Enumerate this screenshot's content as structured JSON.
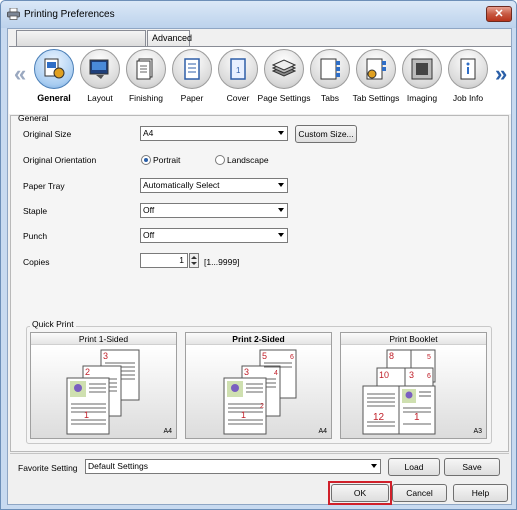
{
  "window": {
    "title": "Printing Preferences",
    "close_label": "✕",
    "app_icon": "printer-icon"
  },
  "tabs": [
    {
      "label": ""
    },
    {
      "label": "Advanced"
    }
  ],
  "nav": {
    "prev": "«",
    "next": "»"
  },
  "icon_tabs": [
    {
      "label": "General",
      "icon": "general-icon",
      "selected": true
    },
    {
      "label": "Layout",
      "icon": "layout-icon"
    },
    {
      "label": "Finishing",
      "icon": "finishing-icon"
    },
    {
      "label": "Paper",
      "icon": "paper-icon"
    },
    {
      "label": "Cover",
      "icon": "cover-icon"
    },
    {
      "label": "Page Settings",
      "icon": "page-settings-icon"
    },
    {
      "label": "Tabs",
      "icon": "tabs-icon"
    },
    {
      "label": "Tab Settings",
      "icon": "tab-settings-icon"
    },
    {
      "label": "Imaging",
      "icon": "imaging-icon"
    },
    {
      "label": "Job Info",
      "icon": "job-info-icon"
    }
  ],
  "general": {
    "title": "General",
    "original_size": {
      "label": "Original Size",
      "value": "A4",
      "custom_button": "Custom Size..."
    },
    "orientation": {
      "label": "Original Orientation",
      "portrait": "Portrait",
      "landscape": "Landscape",
      "selected": "Portrait"
    },
    "paper_tray": {
      "label": "Paper Tray",
      "value": "Automatically Select"
    },
    "staple": {
      "label": "Staple",
      "value": "Off"
    },
    "punch": {
      "label": "Punch",
      "value": "Off"
    },
    "copies": {
      "label": "Copies",
      "value": "1",
      "range": "[1...9999]"
    }
  },
  "quick_print": {
    "title": "Quick Print",
    "items": [
      {
        "label": "Print 1-Sided",
        "size": "A4",
        "pages": [
          "3",
          "2",
          "1"
        ]
      },
      {
        "label": "Print 2-Sided",
        "size": "A4",
        "selected": true,
        "pages": [
          "5",
          "6",
          "3",
          "4",
          "1",
          "2"
        ]
      },
      {
        "label": "Print Booklet",
        "size": "A3",
        "pages": [
          "8",
          "5",
          "10",
          "3",
          "6",
          "12",
          "1"
        ]
      }
    ]
  },
  "favorite": {
    "label": "Favorite Setting",
    "value": "Default Settings",
    "load": "Load",
    "save": "Save"
  },
  "buttons": {
    "ok": "OK",
    "cancel": "Cancel",
    "help": "Help"
  },
  "colors": {
    "highlight": "#d0202a",
    "accent": "#2a5fa8",
    "page_number": "#c0202a"
  }
}
